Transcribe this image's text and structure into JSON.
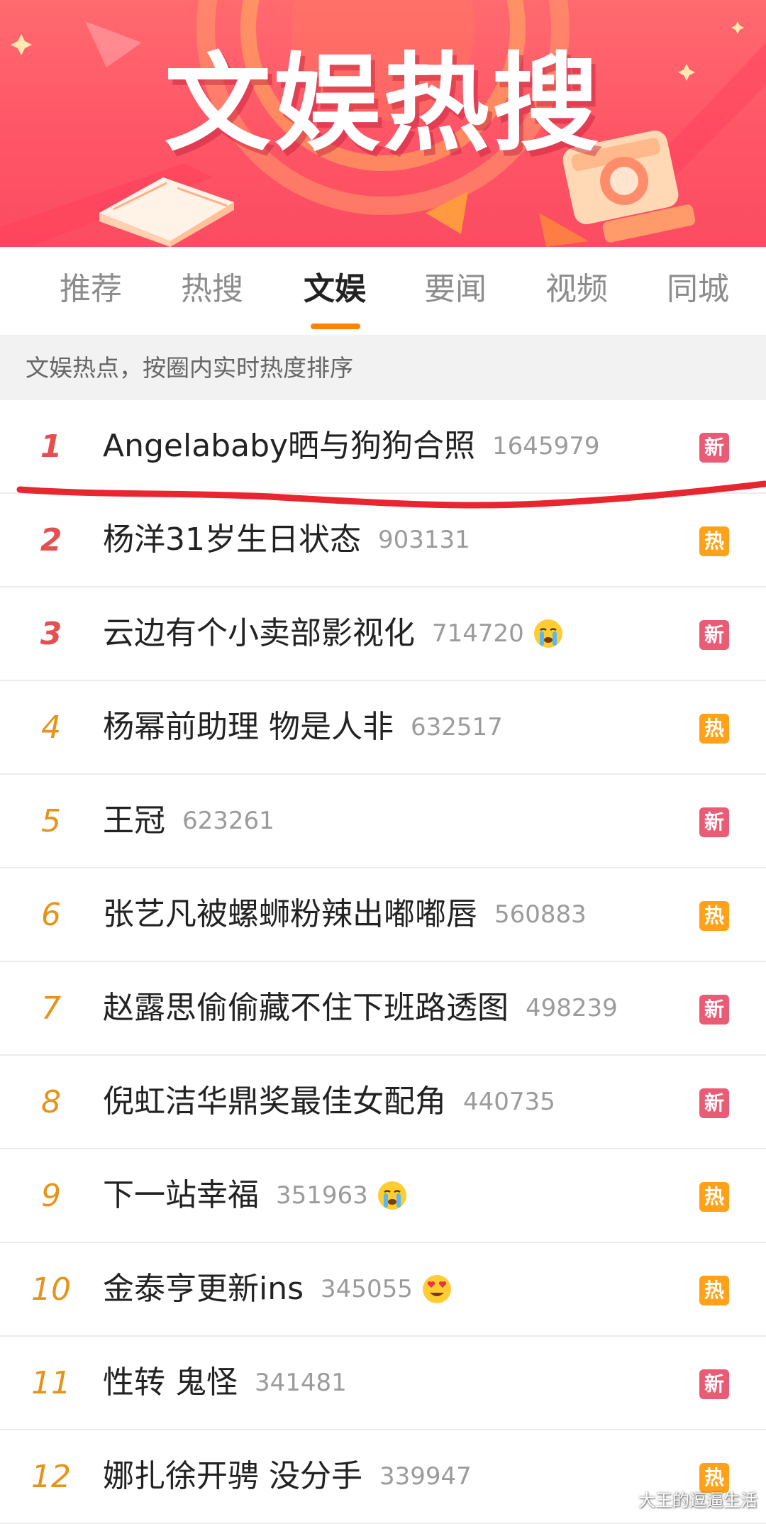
{
  "banner": {
    "title": "文娱热搜"
  },
  "tabs": [
    {
      "label": "推荐",
      "active": false
    },
    {
      "label": "热搜",
      "active": false
    },
    {
      "label": "文娱",
      "active": true
    },
    {
      "label": "要闻",
      "active": false
    },
    {
      "label": "视频",
      "active": false
    },
    {
      "label": "同城",
      "active": false
    }
  ],
  "subheader": {
    "text": "文娱热点，按圈内实时热度排序"
  },
  "colors": {
    "accent": "#ff8200",
    "rank_top": "#e4504f",
    "rank_normal": "#e6931a",
    "badge_new": "#ea5b76",
    "badge_hot": "#ffa219",
    "annotation_line": "#e8262f"
  },
  "items": [
    {
      "rank": "1",
      "title": "Angelababy晒与狗狗合照",
      "heat": "1645979",
      "badge": "新",
      "badge_type": "new",
      "emoji": ""
    },
    {
      "rank": "2",
      "title": "杨洋31岁生日状态",
      "heat": "903131",
      "badge": "热",
      "badge_type": "hot",
      "emoji": ""
    },
    {
      "rank": "3",
      "title": "云边有个小卖部影视化",
      "heat": "714720",
      "badge": "新",
      "badge_type": "new",
      "emoji": "crying-face-icon"
    },
    {
      "rank": "4",
      "title": "杨幂前助理 物是人非",
      "heat": "632517",
      "badge": "热",
      "badge_type": "hot",
      "emoji": ""
    },
    {
      "rank": "5",
      "title": "王冠",
      "heat": "623261",
      "badge": "新",
      "badge_type": "new",
      "emoji": ""
    },
    {
      "rank": "6",
      "title": "张艺凡被螺蛳粉辣出嘟嘟唇",
      "heat": "560883",
      "badge": "热",
      "badge_type": "hot",
      "emoji": ""
    },
    {
      "rank": "7",
      "title": "赵露思偷偷藏不住下班路透图",
      "heat": "498239",
      "badge": "新",
      "badge_type": "new",
      "emoji": ""
    },
    {
      "rank": "8",
      "title": "倪虹洁华鼎奖最佳女配角",
      "heat": "440735",
      "badge": "新",
      "badge_type": "new",
      "emoji": ""
    },
    {
      "rank": "9",
      "title": "下一站幸福",
      "heat": "351963",
      "badge": "热",
      "badge_type": "hot",
      "emoji": "crying-face-icon"
    },
    {
      "rank": "10",
      "title": "金泰亨更新ins",
      "heat": "345055",
      "badge": "热",
      "badge_type": "hot",
      "emoji": "heart-eyes-face-icon"
    },
    {
      "rank": "11",
      "title": "性转 鬼怪",
      "heat": "341481",
      "badge": "新",
      "badge_type": "new",
      "emoji": ""
    },
    {
      "rank": "12",
      "title": "娜扎徐开骋 没分手",
      "heat": "339947",
      "badge": "热",
      "badge_type": "hot",
      "emoji": ""
    }
  ],
  "watermark": "大王的逗逼生活"
}
